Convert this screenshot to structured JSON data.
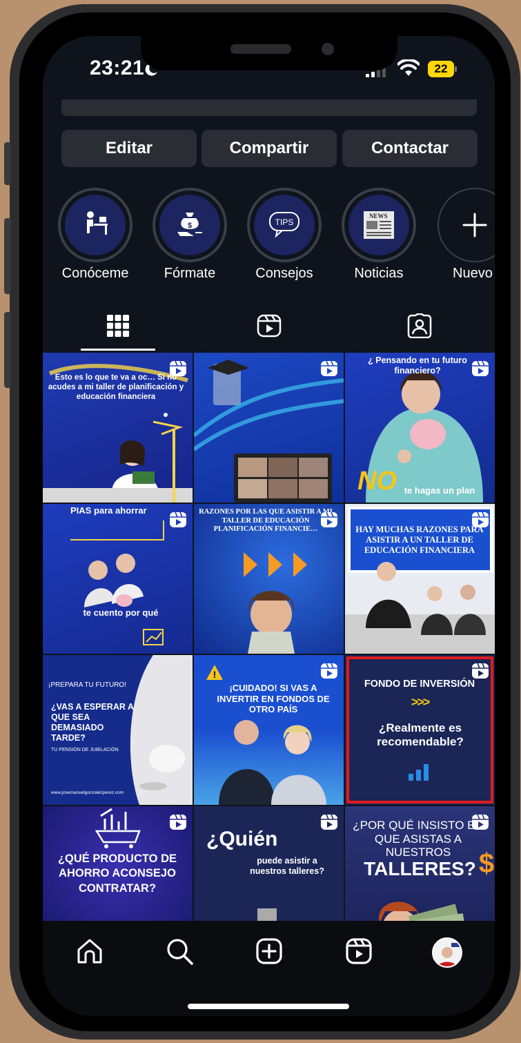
{
  "status_bar": {
    "time": "23:21",
    "battery": "22"
  },
  "profile_actions": {
    "edit": "Editar",
    "share": "Compartir",
    "contact": "Contactar"
  },
  "highlights": [
    {
      "label": "Conóceme",
      "icon": "desk-icon"
    },
    {
      "label": "Fórmate",
      "icon": "money-bag-icon"
    },
    {
      "label": "Consejos",
      "icon": "tips-bubble-icon"
    },
    {
      "label": "Noticias",
      "icon": "newspaper-icon"
    },
    {
      "label": "Nuevo",
      "icon": "plus-icon"
    }
  ],
  "highlight_tips_text": "TIPS",
  "highlight_news_text": "NEWS",
  "tabs": [
    {
      "name": "posts-grid",
      "icon": "grid-icon",
      "active": true
    },
    {
      "name": "reels",
      "icon": "reels-icon",
      "active": false
    },
    {
      "name": "tagged",
      "icon": "tagged-icon",
      "active": false
    }
  ],
  "posts": [
    {
      "text": "Esto es lo que te va a oc… Si no acudes a mi taller de planificación y educación financiera",
      "reel": true
    },
    {
      "text": "",
      "reel": true
    },
    {
      "text": "¿ Pensando en tu futuro financiero?",
      "text2": "NO",
      "text3": "te hagas un plan",
      "reel": true
    },
    {
      "text": "PIAS para ahorrar",
      "text2": "te cuento por qué",
      "reel": true
    },
    {
      "text": "RAZONES POR LAS QUE ASISTIR A MI TALLER DE EDUCACIÓN PLANIFICACIÓN FINANCIE…",
      "reel": true
    },
    {
      "text": "HAY MUCHAS RAZONES PARA ASISTIR A UN TALLER DE EDUCACIÓN FINANCIERA",
      "reel": true
    },
    {
      "text": "¡PREPARA TU FUTURO!",
      "text2": "¿VAS A ESPERAR A QUE SEA DEMASIADO TARDE?",
      "text3": "TU PENSIÓN DE JUBILACIÓN",
      "text4": "www.josemanuelgonzalezperez.com",
      "reel": false
    },
    {
      "text": "¡CUIDADO! SI VAS A INVERTIR EN FONDOS DE OTRO PAÍS",
      "reel": true
    },
    {
      "text": "FONDO DE INVERSIÓN",
      "text2": ">>>",
      "text3": "¿Realmente es recomendable?",
      "reel": true,
      "selected": true
    },
    {
      "text": "¿QUÉ PRODUCTO DE AHORRO ACONSEJO CONTRATAR?",
      "reel": true
    },
    {
      "text": "¿Quién",
      "text2": "puede asistir a nuestros talleres?",
      "reel": true
    },
    {
      "text": "¿POR QUÉ INSISTO EN QUE ASISTAS A NUESTROS",
      "text2": "TALLERES?",
      "reel": true
    }
  ],
  "bottom_nav": [
    "home-icon",
    "search-icon",
    "create-icon",
    "reels-icon",
    "profile-avatar"
  ],
  "colors": {
    "accent_blue": "#1c3fb8",
    "navy": "#1c2560",
    "selection": "#e01b1b",
    "battery": "#ffd60a"
  }
}
